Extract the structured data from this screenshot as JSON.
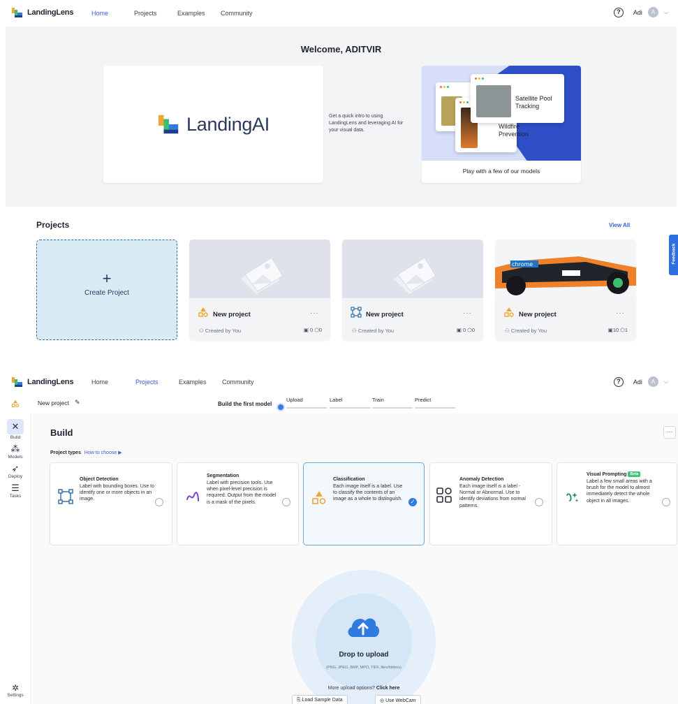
{
  "top_nav": {
    "brand": "LandingLens",
    "links": [
      "Home",
      "Projects",
      "Examples",
      "Community"
    ],
    "active_top": "Home",
    "user": "Adi",
    "avatar_initial": "A"
  },
  "hero": {
    "welcome": "Welcome, ADITVIR",
    "video_logo": "LandingAI",
    "intro": "Get a quick intro to using LandingLens and leveraging AI for your visual data.",
    "models_caption": "Play with a few of our models",
    "model_cards": [
      "Satellite Pool Tracking",
      "Wildfire Prevention"
    ]
  },
  "projects": {
    "title": "Projects",
    "view_all": "View All",
    "create_label": "Create Project",
    "items": [
      {
        "name": "New project",
        "created": "Created by You",
        "images": "0",
        "models": "0",
        "type": "classification"
      },
      {
        "name": "New project",
        "created": "Created by You",
        "images": "0",
        "models": "0",
        "type": "object-detection"
      },
      {
        "name": "New project",
        "created": "Created by You",
        "images": "10",
        "models": "1",
        "type": "classification"
      }
    ],
    "feedback": "Feedback"
  },
  "bottom_nav": {
    "brand": "LandingLens",
    "links": [
      "Home",
      "Projects",
      "Examples",
      "Community"
    ],
    "active": "Projects",
    "user": "Adi",
    "avatar_initial": "A"
  },
  "subbar": {
    "project_name": "New project",
    "build_first": "Build the first model",
    "steps": [
      "Upload",
      "Label",
      "Train",
      "Predict"
    ]
  },
  "sidebar": {
    "items": [
      "Build",
      "Models",
      "Deploy",
      "Tasks"
    ],
    "settings": "Settings"
  },
  "build": {
    "title": "Build",
    "more": "···",
    "project_types_label": "Project types",
    "how_to_choose": "How to choose",
    "types": [
      {
        "title": "Object Detection",
        "desc": "Label with bounding boxes. Use to identify one or more objects in an image.",
        "selected": false
      },
      {
        "title": "Segmentation",
        "desc": "Label with precision tools. Use when pixel-level precision is required. Output from the model is a mask of the pixels.",
        "selected": false
      },
      {
        "title": "Classification",
        "desc": "Each image itself is a label. Use to classify the contents of an image as a whole to distinguish.",
        "selected": true
      },
      {
        "title": "Anomaly Detection",
        "desc": "Each image itself is a label - Normal or Abnormal. Use to identify deviations from normal patterns.",
        "selected": false
      },
      {
        "title": "Visual Prompting",
        "badge": "Beta",
        "desc": "Label a few small areas with a brush for the model to almost immediately detect the whole object in all images.",
        "selected": false
      }
    ]
  },
  "upload": {
    "label": "Drop to upload",
    "formats": "(PNG, JPEG, BMP, MPO, TIFF, files/folders)",
    "more_options": "More upload options?",
    "click_here": "Click here",
    "load_sample": "Load Sample Data",
    "use_webcam": "Use WebCam"
  },
  "colors": {
    "accent": "#3a5bd9",
    "selected_radio": "#2f7be0",
    "create_card_bg": "#d9ecf5",
    "feedback_bg": "#2f6ee0"
  }
}
